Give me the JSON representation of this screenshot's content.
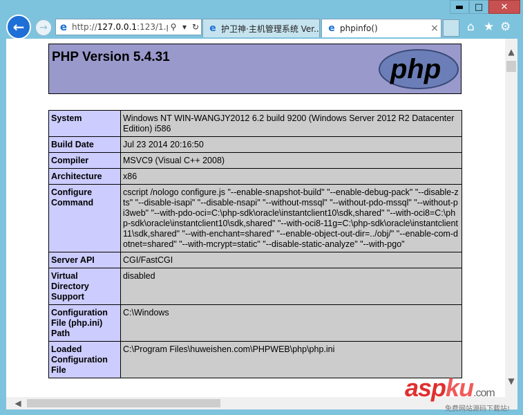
{
  "browser": {
    "address": {
      "prefix": "http://",
      "host": "127.0.0.1",
      "rest": ":123/1.p"
    },
    "tabs": [
      {
        "label": "护卫神·主机管理系统 Ver...",
        "active": false
      },
      {
        "label": "phpinfo()",
        "active": true
      }
    ],
    "window_controls": {
      "minimize": "▬",
      "maximize": "□",
      "close": "✕"
    },
    "icons": [
      "back-arrow-icon",
      "forward-arrow-icon",
      "ie-logo-icon",
      "search-icon",
      "dropdown-icon",
      "refresh-icon",
      "home-icon",
      "favorites-star-icon",
      "settings-gear-icon"
    ]
  },
  "page": {
    "title": "PHP Version 5.4.31",
    "logo_text": "php",
    "rows": [
      {
        "key": "System",
        "value": "Windows NT WIN-WANGJY2012 6.2 build 9200 (Windows Server 2012 R2 Datacenter Edition) i586"
      },
      {
        "key": "Build Date",
        "value": "Jul 23 2014 20:16:50"
      },
      {
        "key": "Compiler",
        "value": "MSVC9 (Visual C++ 2008)"
      },
      {
        "key": "Architecture",
        "value": "x86"
      },
      {
        "key": "Configure Command",
        "value": "cscript /nologo configure.js \"--enable-snapshot-build\" \"--enable-debug-pack\" \"--disable-zts\" \"--disable-isapi\" \"--disable-nsapi\" \"--without-mssql\" \"--without-pdo-mssql\" \"--without-pi3web\" \"--with-pdo-oci=C:\\php-sdk\\oracle\\instantclient10\\sdk,shared\" \"--with-oci8=C:\\php-sdk\\oracle\\instantclient10\\sdk,shared\" \"--with-oci8-11g=C:\\php-sdk\\oracle\\instantclient11\\sdk,shared\" \"--with-enchant=shared\" \"--enable-object-out-dir=../obj/\" \"--enable-com-dotnet=shared\" \"--with-mcrypt=static\" \"--disable-static-analyze\" \"--with-pgo\""
      },
      {
        "key": "Server API",
        "value": "CGI/FastCGI"
      },
      {
        "key": "Virtual Directory Support",
        "value": "disabled"
      },
      {
        "key": "Configuration File (php.ini) Path",
        "value": "C:\\Windows"
      },
      {
        "key": "Loaded Configuration File",
        "value": "C:\\Program Files\\huweishen.com\\PHPWEB\\php\\php.ini"
      }
    ]
  },
  "watermark": {
    "asp": "asp",
    "ku": "ku",
    "com": ".com",
    "sub": "免费网站源码下载站!"
  }
}
